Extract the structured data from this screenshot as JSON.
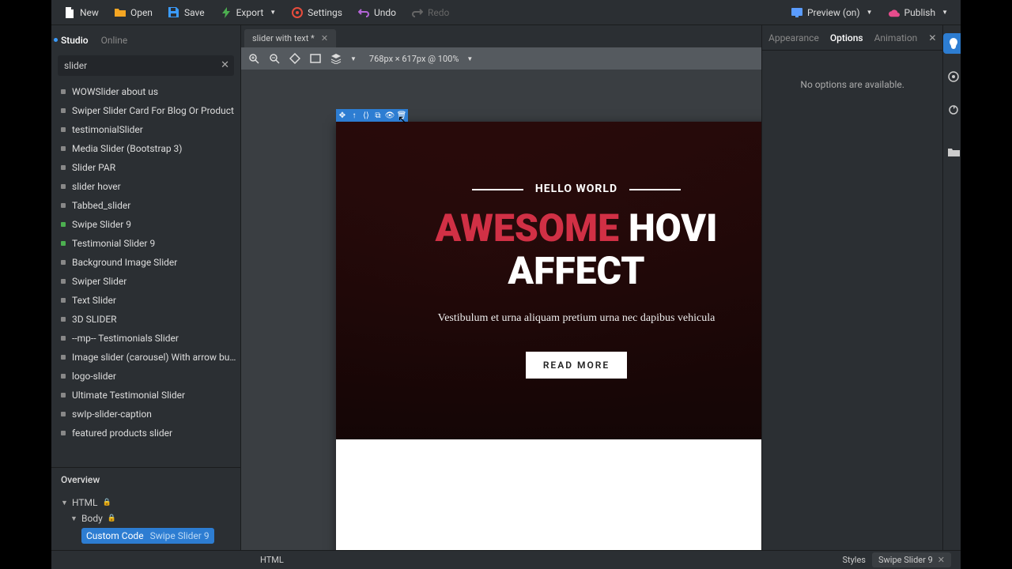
{
  "toolbar": {
    "new": "New",
    "open": "Open",
    "save": "Save",
    "export": "Export",
    "settings": "Settings",
    "undo": "Undo",
    "redo": "Redo",
    "preview": "Preview (on)",
    "publish": "Publish"
  },
  "left_tabs": {
    "studio": "Studio",
    "online": "Online"
  },
  "search": {
    "value": "slider"
  },
  "list_items": [
    {
      "label": "WOWSlider about us",
      "c": "#888"
    },
    {
      "label": "Swiper Slider Card For Blog Or Product",
      "c": "#888"
    },
    {
      "label": "testimonialSlider",
      "c": "#888"
    },
    {
      "label": "Media Slider (Bootstrap 3)",
      "c": "#888"
    },
    {
      "label": "Slider PAR",
      "c": "#888"
    },
    {
      "label": "slider hover",
      "c": "#888"
    },
    {
      "label": "Tabbed_slider",
      "c": "#888"
    },
    {
      "label": "Swipe Slider 9",
      "c": "#4caf50"
    },
    {
      "label": "Testimonial Slider 9",
      "c": "#4caf50"
    },
    {
      "label": "Background Image Slider",
      "c": "#888"
    },
    {
      "label": "Swiper Slider",
      "c": "#888"
    },
    {
      "label": "Text Slider",
      "c": "#888"
    },
    {
      "label": "3D SLIDER",
      "c": "#888"
    },
    {
      "label": "--mp-- Testimonials Slider",
      "c": "#888"
    },
    {
      "label": "Image slider (carousel) With arrow bu…",
      "c": "#888"
    },
    {
      "label": "logo-slider",
      "c": "#888"
    },
    {
      "label": "Ultimate Testimonial Slider",
      "c": "#888"
    },
    {
      "label": "swIp-slider-caption",
      "c": "#888"
    },
    {
      "label": "featured products slider",
      "c": "#888"
    }
  ],
  "overview": {
    "header": "Overview",
    "html": "HTML",
    "body": "Body",
    "custom_code": "Custom Code",
    "custom_code_sub": "Swipe Slider 9"
  },
  "file_tab": "slider with text *",
  "canvas_info": "768px × 617px @ 100%",
  "hero": {
    "kicker": "HELLO WORLD",
    "title_red": "AWESOME",
    "title_w1": "HOVI",
    "title_w2": "AFFECT",
    "sub": "Vestibulum et urna aliquam pretium urna nec dapibus vehicula",
    "btn": "READ MORE"
  },
  "right_tabs": {
    "appearance": "Appearance",
    "options": "Options",
    "animation": "Animation"
  },
  "right_msg": "No options are available.",
  "footer": {
    "html": "HTML",
    "styles": "Styles",
    "chip": "Swipe Slider 9"
  }
}
